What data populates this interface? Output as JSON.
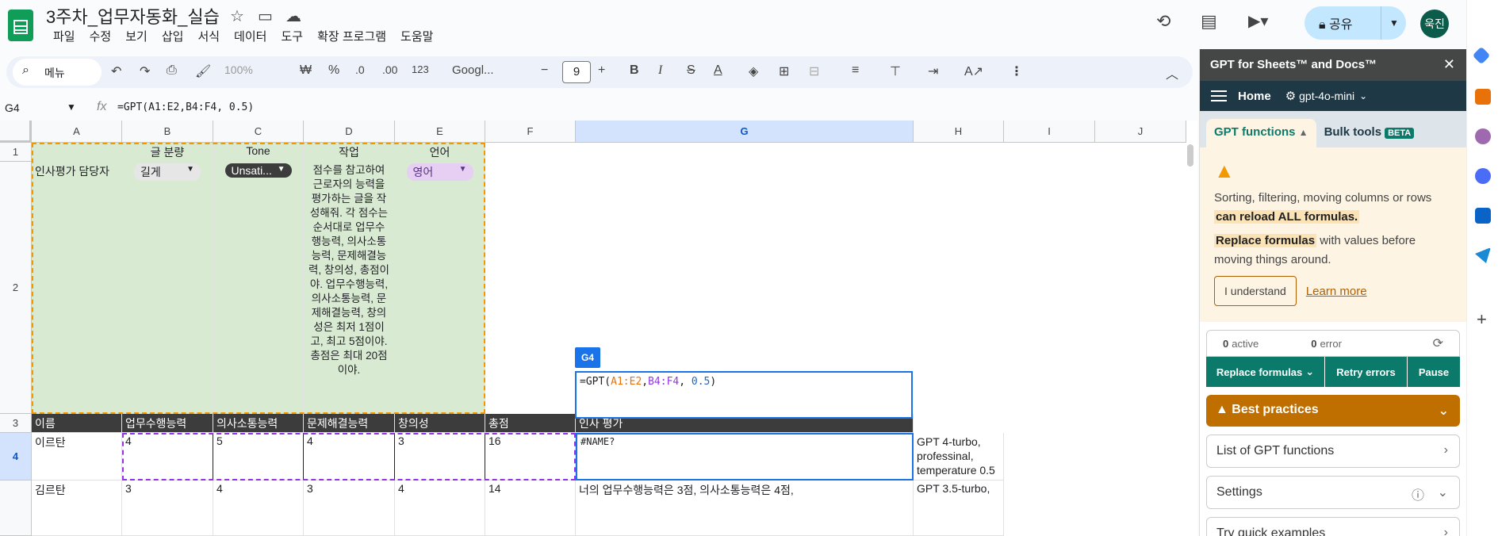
{
  "doc": {
    "title": "3주차_업무자동화_실습"
  },
  "menu": [
    "파일",
    "수정",
    "보기",
    "삽입",
    "서식",
    "데이터",
    "도구",
    "확장 프로그램",
    "도움말"
  ],
  "share": {
    "label": "공유"
  },
  "user": {
    "initials": "욱진"
  },
  "toolbar": {
    "search_placeholder": "메뉴",
    "zoom": "100%",
    "currency": "₩",
    "percent": "%",
    "dec_less": ".0",
    "dec_more": ".00",
    "format_num": "123",
    "font": "Googl...",
    "font_size": "9"
  },
  "formula_bar": {
    "cell_ref": "G4",
    "formula": "=GPT(A1:E2,B4:F4, 0.5)"
  },
  "columns": [
    "A",
    "B",
    "C",
    "D",
    "E",
    "F",
    "G",
    "H",
    "I",
    "J"
  ],
  "rows": [
    "1",
    "2",
    "3",
    "4"
  ],
  "row1": {
    "b": "글 분량",
    "c": "Tone",
    "d": "작업",
    "e": "언어"
  },
  "row2": {
    "a": "인사평가 담당자",
    "b_chip": "길게",
    "c_chip": "Unsati...",
    "d": "점수를 참고하여 근로자의 능력을 평가하는 글을 작성해줘. 각 점수는 순서대로 업무수행능력, 의사소통능력, 문제해결능력, 창의성, 총점이야. 업무수행능력, 의사소통능력, 문제해결능력, 창의성은 최저 1점이고, 최고 5점이야. 총점은 최대 20점이야.",
    "e_chip": "영어"
  },
  "header_row": [
    "이름",
    "업무수행능력",
    "의사소통능력",
    "문제해결능력",
    "창의성",
    "총점",
    "인사 평가"
  ],
  "data_rows": [
    {
      "name": "이르탄",
      "v": [
        "4",
        "5",
        "4",
        "3",
        "16"
      ],
      "eval": "#NAME?",
      "note": "GPT 4-turbo, professinal, temperature 0.5"
    },
    {
      "name": "김르탄",
      "v": [
        "3",
        "4",
        "3",
        "4",
        "14"
      ],
      "eval": "너의 업무수행능력은 3점, 의사소통능력은 4점,",
      "note": "GPT 3.5-turbo,"
    }
  ],
  "editor": {
    "tag": "G4",
    "fn": "=GPT(",
    "ref1": "A1:E2",
    "comma1": ",",
    "ref2": "B4:F4",
    "rest": ", ",
    "num": "0.5",
    "close": ")"
  },
  "panel": {
    "title": "GPT for Sheets™ and Docs™",
    "home": "Home",
    "model": "gpt-4o-mini",
    "tab_functions": "GPT functions",
    "tab_bulk": "Bulk tools",
    "beta": "BETA",
    "warn_line1": "Sorting, filtering, moving columns or rows",
    "warn_hl1": "can reload ALL formulas.",
    "warn_hl2": "Replace formulas",
    "warn_line2": "with values before moving things around.",
    "understand": "I understand",
    "learn_more": "Learn more",
    "active_count": "0",
    "active_label": "active",
    "error_count": "0",
    "error_label": "error",
    "btn_replace": "Replace formulas",
    "btn_retry": "Retry errors",
    "btn_pause": "Pause",
    "best_practices": "Best practices",
    "list_functions": "List of GPT functions",
    "settings": "Settings",
    "quick_examples": "Try quick examples"
  },
  "colors": {
    "accent": "#0b7a6a",
    "warn": "#bf6f00",
    "select": "#1a73e8"
  }
}
